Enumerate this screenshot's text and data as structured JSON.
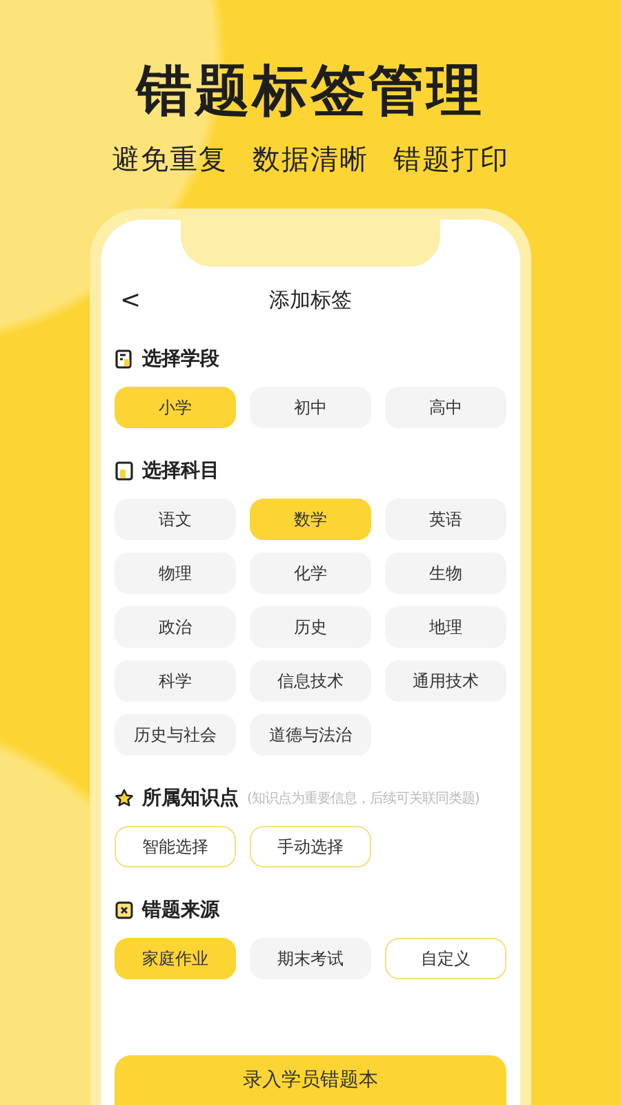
{
  "headline": "错题标签管理",
  "taglines": [
    "避免重复",
    "数据清晰",
    "错题打印"
  ],
  "screen": {
    "back": "<",
    "title": "添加标签",
    "sections": [
      {
        "title": "选择学段",
        "chips": [
          {
            "label": "小学",
            "kind": "plain",
            "selected": true
          },
          {
            "label": "初中",
            "kind": "plain",
            "selected": false
          },
          {
            "label": "高中",
            "kind": "plain",
            "selected": false
          }
        ]
      },
      {
        "title": "选择科目",
        "chips": [
          {
            "label": "语文",
            "kind": "plain",
            "selected": false
          },
          {
            "label": "数学",
            "kind": "plain",
            "selected": true
          },
          {
            "label": "英语",
            "kind": "plain",
            "selected": false
          },
          {
            "label": "物理",
            "kind": "plain",
            "selected": false
          },
          {
            "label": "化学",
            "kind": "plain",
            "selected": false
          },
          {
            "label": "生物",
            "kind": "plain",
            "selected": false
          },
          {
            "label": "政治",
            "kind": "plain",
            "selected": false
          },
          {
            "label": "历史",
            "kind": "plain",
            "selected": false
          },
          {
            "label": "地理",
            "kind": "plain",
            "selected": false
          },
          {
            "label": "科学",
            "kind": "plain",
            "selected": false
          },
          {
            "label": "信息技术",
            "kind": "plain",
            "selected": false
          },
          {
            "label": "通用技术",
            "kind": "plain",
            "selected": false
          },
          {
            "label": "历史与社会",
            "kind": "plain",
            "selected": false
          },
          {
            "label": "道德与法治",
            "kind": "plain",
            "selected": false
          }
        ]
      },
      {
        "title": "所属知识点",
        "hint": "(知识点为重要信息，后续可关联同类题)",
        "chips": [
          {
            "label": "智能选择",
            "kind": "outline",
            "selected": false
          },
          {
            "label": "手动选择",
            "kind": "outline",
            "selected": false
          }
        ]
      },
      {
        "title": "错题来源",
        "chips": [
          {
            "label": "家庭作业",
            "kind": "plain",
            "selected": true
          },
          {
            "label": "期末考试",
            "kind": "plain",
            "selected": false
          },
          {
            "label": "自定义",
            "kind": "outline",
            "selected": false
          }
        ]
      }
    ],
    "submit": "录入学员错题本"
  }
}
